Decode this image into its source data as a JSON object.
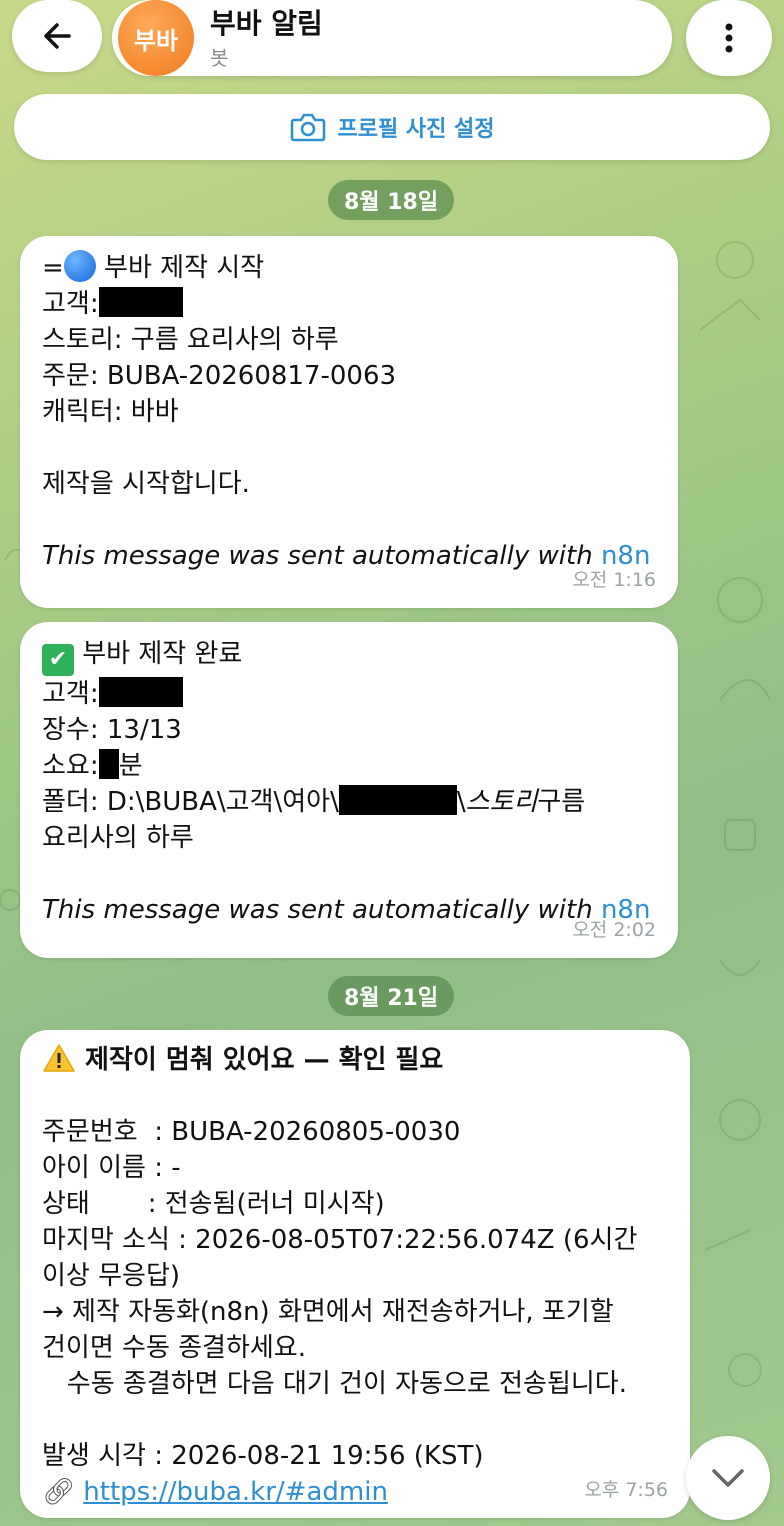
{
  "header": {
    "back_icon": "arrow-left-icon",
    "avatar_text": "부바",
    "title": "부바 알림",
    "subtitle": "봇",
    "menu_icon": "more-vertical-icon"
  },
  "profile_button": {
    "icon": "camera-icon",
    "label": "프로필 사진 설정"
  },
  "dates": [
    "8월 18일",
    "8월 21일"
  ],
  "messages": [
    {
      "lines": [
        "=",
        " 부바 제작 시작",
        "고객:",
        "스토리: 구름 요리사의 하루",
        "주문: BUBA-20260817-0063",
        "캐릭터: 바바",
        "제작을 시작합니다."
      ],
      "footer_text": "This message was sent automatically with ",
      "footer_link": "n8n",
      "time": "오전 1:16"
    },
    {
      "lines": [
        " 부바 제작 완료",
        "고객:",
        "장수: 13/13",
        "소요:",
        "분",
        "폴더: D:\\BUBA\\고객\\여아\\",
        "\\",
        "스토리",
        "구름",
        "요리사의 하루"
      ],
      "footer_text": "This message was sent automatically with ",
      "footer_link": "n8n",
      "time": "오전 2:02"
    },
    {
      "title": " 제작이 멈춰 있어요 — 확인 필요",
      "lines": [
        "주문번호  : BUBA-20260805-0030",
        "아이 이름 : -",
        "상태       : 전송됨(러너 미시작)",
        "마지막 소식 : 2026-08-05T07:22:56.074Z (6시간",
        "이상 무응답)",
        "→ 제작 자동화(n8n) 화면에서 재전송하거나, 포기할",
        "건이면 수동 종결하세요.",
        "   수동 종결하면 다음 대기 건이 자동으로 전송됩니다.",
        "발생 시각 : 2026-08-21 19:56 (KST)"
      ],
      "link_icon": "link-icon",
      "link": "https://buba.kr/#admin",
      "time": "오후 7:56"
    }
  ],
  "scroll_down_icon": "chevron-down-icon",
  "colors": {
    "accent": "#2f8fd3",
    "avatar": "#f07a1e",
    "date_pill": "#5a8c50"
  }
}
